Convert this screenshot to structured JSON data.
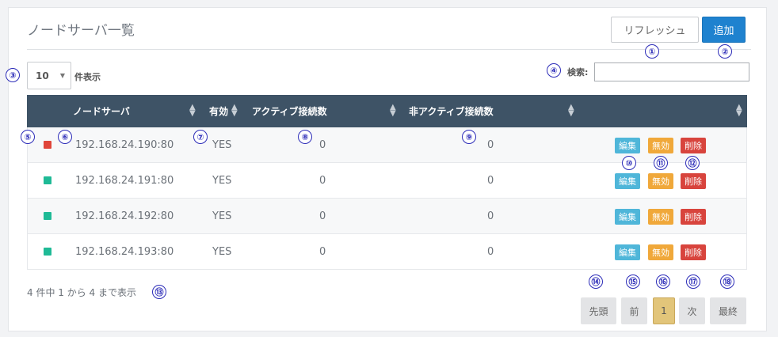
{
  "header": {
    "title": "ノードサーバ一覧",
    "refresh_label": "リフレッシュ",
    "add_label": "追加"
  },
  "controls": {
    "page_size": "10",
    "page_size_suffix": "件表示",
    "search_label": "検索:",
    "search_value": ""
  },
  "table": {
    "columns": [
      "ノードサーバ",
      "有効",
      "アクティブ接続数",
      "非アクティブ接続数",
      ""
    ],
    "rows": [
      {
        "status_color": "#e0453a",
        "server": "192.168.24.190:80",
        "enabled": "YES",
        "active": "0",
        "inactive": "0"
      },
      {
        "status_color": "#1fba96",
        "server": "192.168.24.191:80",
        "enabled": "YES",
        "active": "0",
        "inactive": "0"
      },
      {
        "status_color": "#1fba96",
        "server": "192.168.24.192:80",
        "enabled": "YES",
        "active": "0",
        "inactive": "0"
      },
      {
        "status_color": "#1fba96",
        "server": "192.168.24.193:80",
        "enabled": "YES",
        "active": "0",
        "inactive": "0"
      }
    ],
    "actions": {
      "edit": "編集",
      "disable": "無効",
      "delete": "削除"
    }
  },
  "footer": {
    "info": "4 件中 1 から 4 まで表示",
    "pagination": {
      "first": "先頭",
      "prev": "前",
      "current": "1",
      "next": "次",
      "last": "最終"
    }
  },
  "markers": [
    "①",
    "②",
    "③",
    "④",
    "⑤",
    "⑥",
    "⑦",
    "⑧",
    "⑨",
    "⑩",
    "⑪",
    "⑫",
    "⑬",
    "⑭",
    "⑮",
    "⑯",
    "⑰",
    "⑱"
  ],
  "colors": {
    "accent": "#1f82cf",
    "header_bg": "#3e5366",
    "edit": "#4fb6d9",
    "disable": "#f0a83a",
    "delete": "#d8443d",
    "active_page": "#e2c57a",
    "marker": "#2c2cb8"
  }
}
